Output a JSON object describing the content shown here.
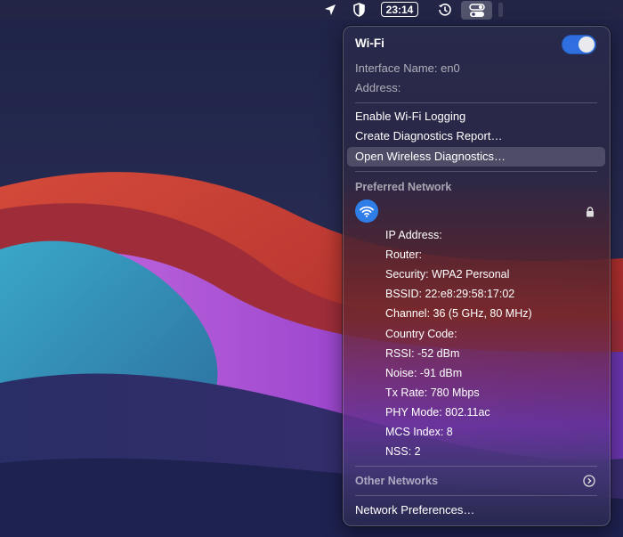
{
  "menubar": {
    "clock": "23:14",
    "icons": [
      "location-arrow-icon",
      "shield-icon",
      "time-machine-icon",
      "control-center-icon"
    ]
  },
  "wifi_menu": {
    "title": "Wi-Fi",
    "toggle_on": true,
    "interface_name": "Interface Name: en0",
    "address": "Address:",
    "actions": {
      "enable_logging": "Enable Wi-Fi Logging",
      "create_report": "Create Diagnostics Report…",
      "open_diagnostics": "Open Wireless Diagnostics…"
    },
    "preferred_network_header": "Preferred Network",
    "details": [
      {
        "key": "ip",
        "text": "IP Address:"
      },
      {
        "key": "router",
        "text": "Router:"
      },
      {
        "key": "security",
        "text": "Security: WPA2 Personal"
      },
      {
        "key": "bssid",
        "text": "BSSID: 22:e8:29:58:17:02"
      },
      {
        "key": "channel",
        "text": "Channel: 36 (5 GHz, 80 MHz)"
      },
      {
        "key": "country",
        "text": "Country Code:"
      },
      {
        "key": "rssi",
        "text": "RSSI: -52 dBm"
      },
      {
        "key": "noise",
        "text": "Noise: -91 dBm"
      },
      {
        "key": "txrate",
        "text": "Tx Rate: 780 Mbps"
      },
      {
        "key": "phy",
        "text": "PHY Mode: 802.11ac"
      },
      {
        "key": "mcs",
        "text": "MCS Index: 8"
      },
      {
        "key": "nss",
        "text": "NSS: 2"
      }
    ],
    "other_networks": "Other Networks",
    "network_preferences": "Network Preferences…",
    "accent_color": "#2f6fe0"
  }
}
